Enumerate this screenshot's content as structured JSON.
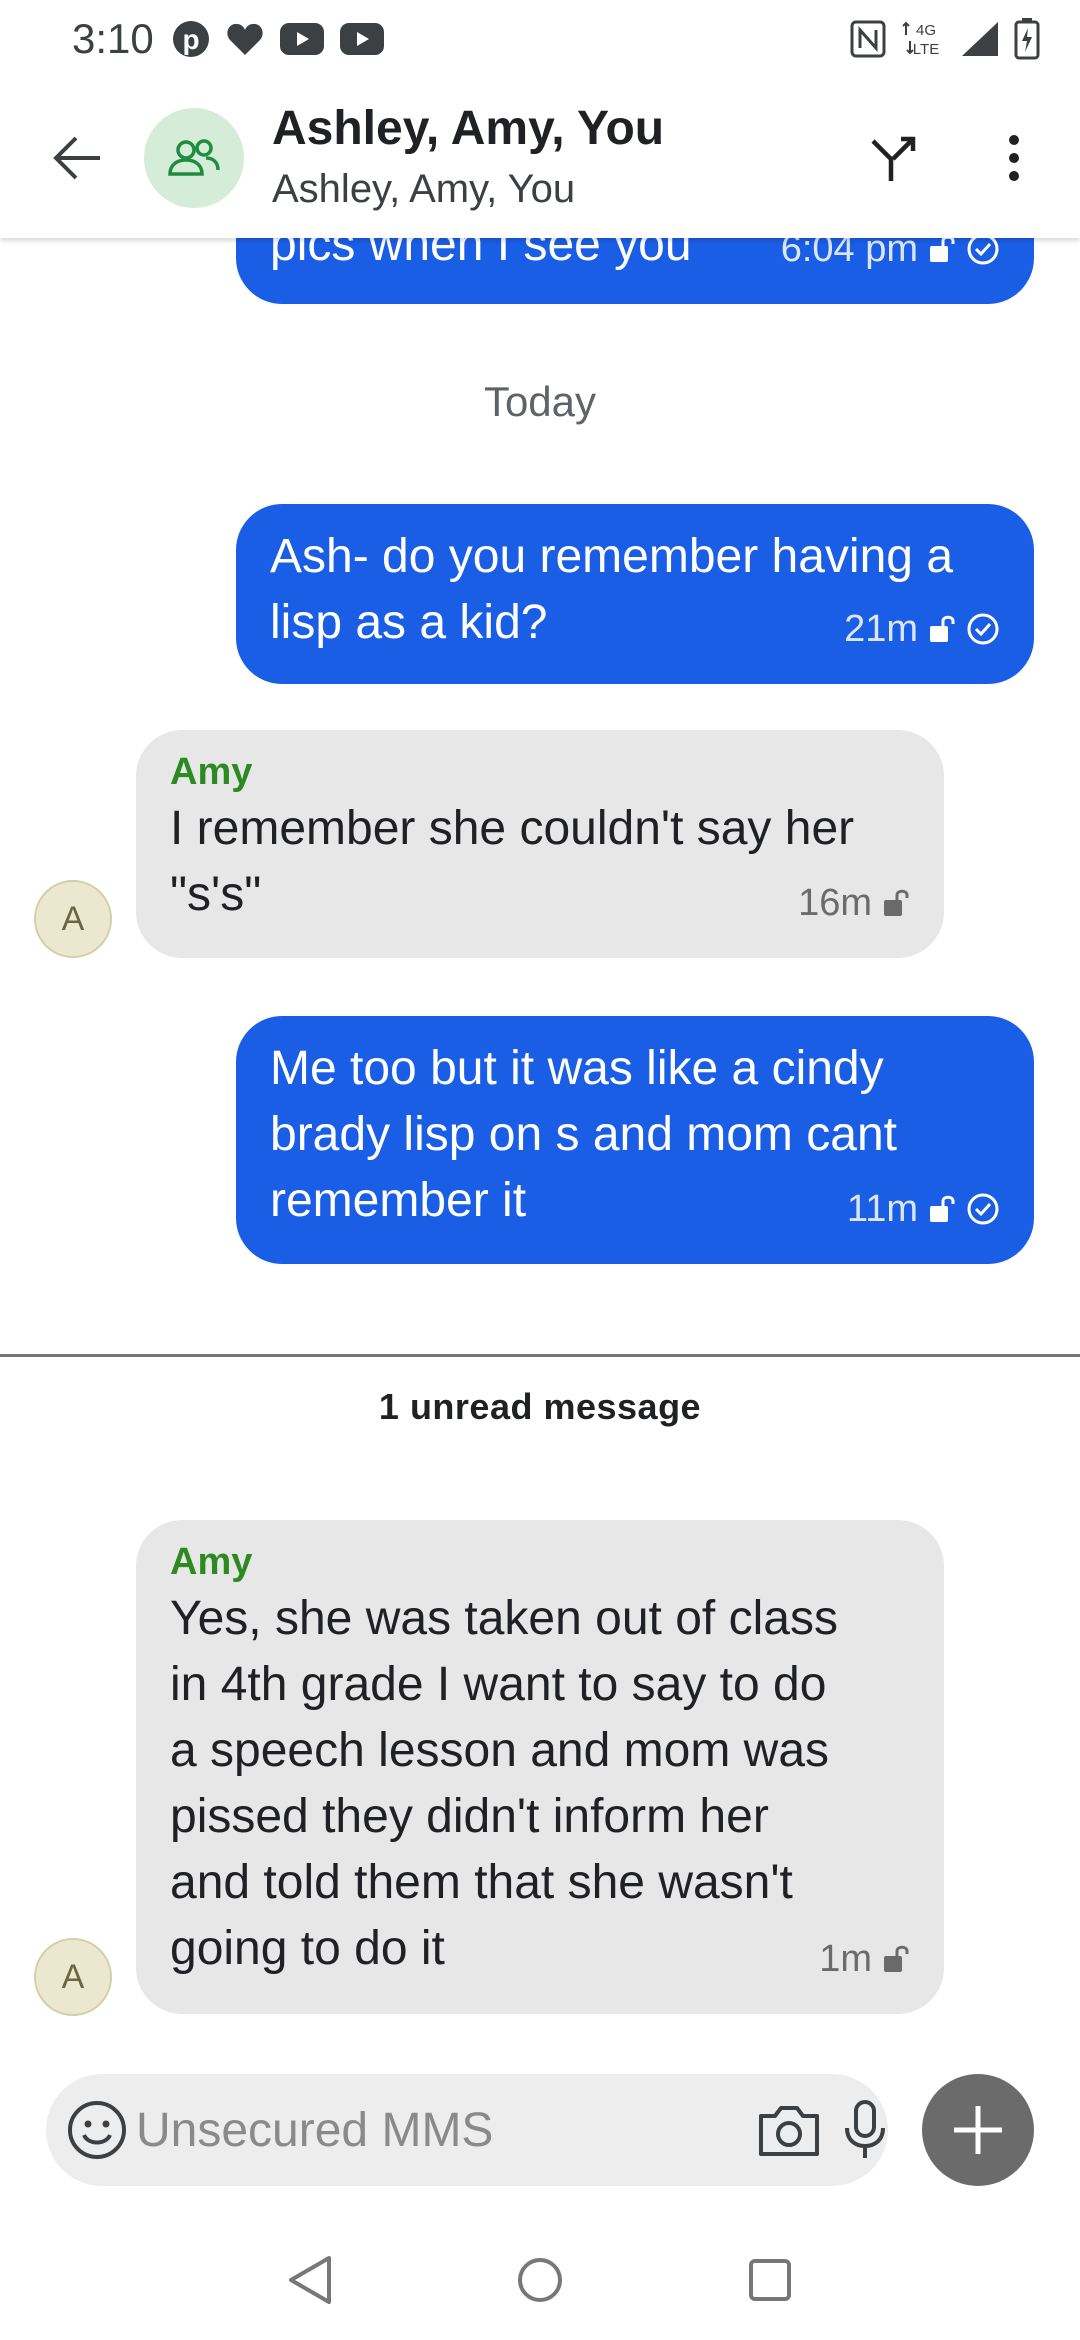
{
  "status_bar": {
    "time": "3:10",
    "left_icons": [
      "pinterest-icon",
      "heart-icon",
      "youtube-icon",
      "youtube-icon"
    ],
    "right_icons": [
      "nfc-icon",
      "4g-lte-icon",
      "signal-icon",
      "battery-icon"
    ],
    "network_label_top": "4G",
    "network_label_bottom": "LTE"
  },
  "app_bar": {
    "title": "Ashley, Amy, You",
    "subtitle": "Ashley, Amy, You",
    "avatar_icon": "group-icon",
    "actions": [
      "merge-icon",
      "more-vert-icon"
    ]
  },
  "messages": {
    "top_partial": {
      "text": "pics when I see you",
      "time": "6:04 pm"
    },
    "day_divider": "Today",
    "items": [
      {
        "direction": "outgoing",
        "text": "Ash- do you remember having a\nlisp as a kid?",
        "time": "21m"
      },
      {
        "direction": "incoming",
        "sender": "Amy",
        "avatar": "A",
        "text": "I remember she couldn't say her\n\"s's\"",
        "time": "16m"
      },
      {
        "direction": "outgoing",
        "text": "Me too but it was like a cindy\nbrady lisp on s and mom cant\nremember it",
        "time": "11m"
      },
      {
        "direction": "incoming",
        "sender": "Amy",
        "avatar": "A",
        "text": "Yes, she was taken out of class\nin 4th grade I want to say to do\na speech lesson and mom was\npissed they didn't inform her\nand told them that she wasn't\ngoing to do it",
        "time": "1m"
      }
    ],
    "unread_label": "1 unread message"
  },
  "compose": {
    "placeholder": "Unsecured MMS",
    "value": ""
  },
  "colors": {
    "outgoing_bubble": "#1a5ee6",
    "incoming_bubble": "#e7e7e7",
    "sender_name": "#2d8a20",
    "group_avatar_bg": "#d5ecd9",
    "fab": "#6b6b6b"
  }
}
